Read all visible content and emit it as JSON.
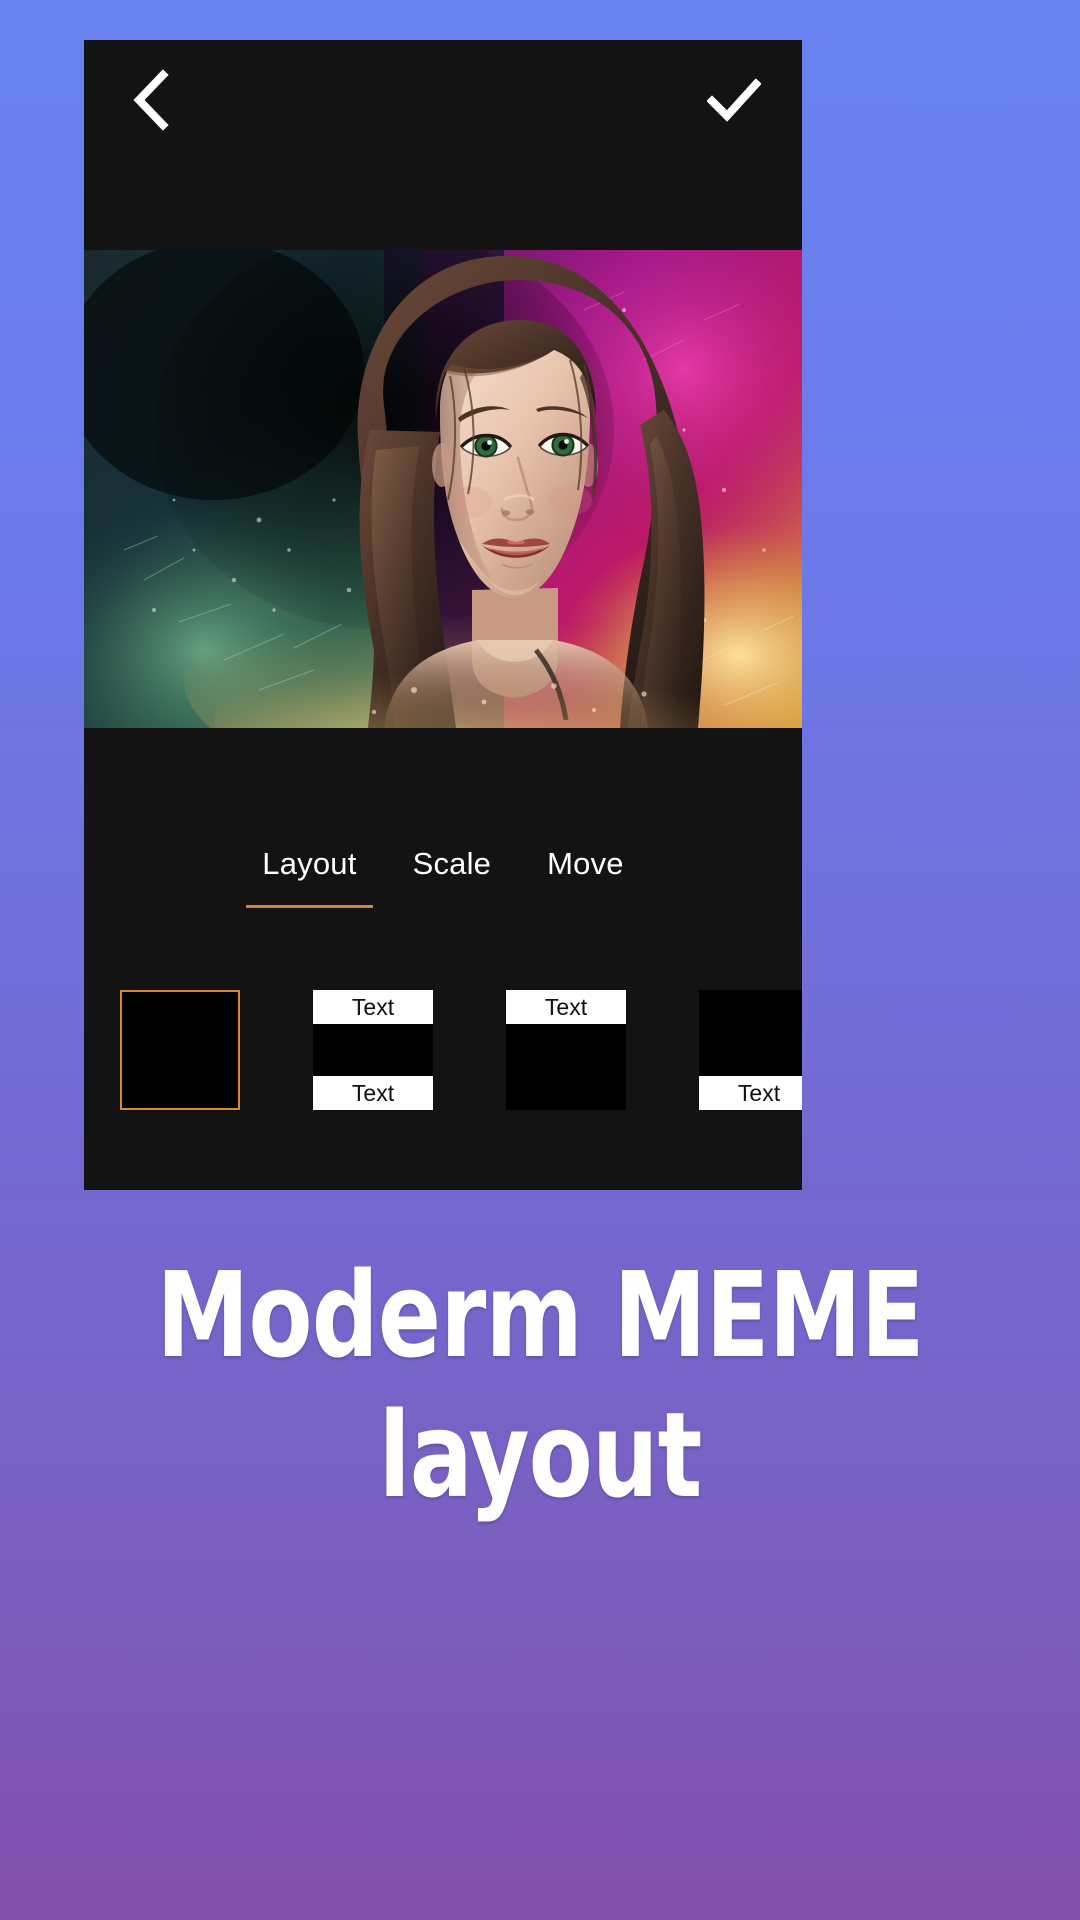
{
  "background": {
    "gradient_top": "#6a82f1",
    "gradient_bottom": "#8350ac"
  },
  "app": {
    "panel_bg": "#131313",
    "accent_color": "#d4873f",
    "top_bar": {
      "back_icon": "chevron-left-icon",
      "back_label": "Back",
      "confirm_icon": "check-icon",
      "confirm_label": "Done"
    },
    "canvas": {
      "image_alt": "Portrait of a woman with colorful paint-splatter artistic effect"
    },
    "tabs": [
      {
        "label": "Layout",
        "active": true
      },
      {
        "label": "Scale",
        "active": false
      },
      {
        "label": "Move",
        "active": false
      }
    ],
    "layouts": [
      {
        "name": "no-text",
        "selected": true,
        "top_text": "",
        "bottom_text": ""
      },
      {
        "name": "text-top-and-bottom",
        "selected": false,
        "top_text": "Text",
        "bottom_text": "Text"
      },
      {
        "name": "text-top",
        "selected": false,
        "top_text": "Text",
        "bottom_text": ""
      },
      {
        "name": "text-bottom",
        "selected": false,
        "top_text": "",
        "bottom_text": "Text"
      }
    ]
  },
  "promo": {
    "line1": "Moderm MEME",
    "line2": "layout"
  }
}
